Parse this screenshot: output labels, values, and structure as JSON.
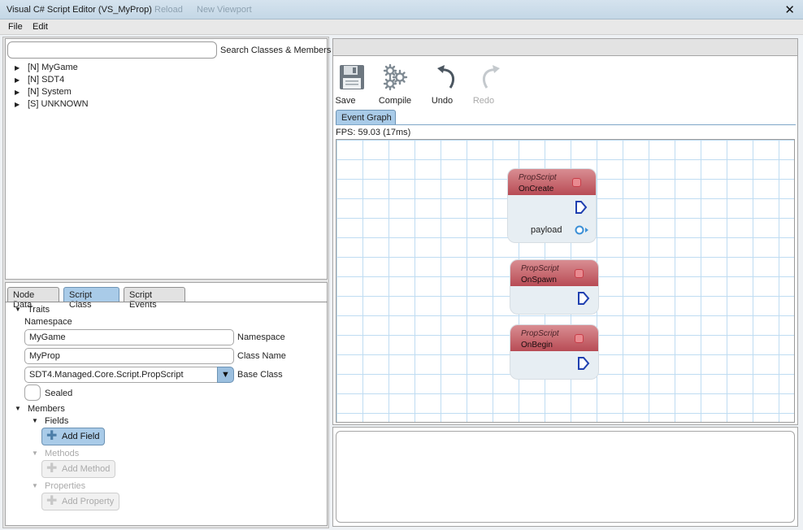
{
  "window": {
    "title": "Visual C# Script Editor (VS_MyProp)",
    "ghost_menu": [
      "Reload",
      "New Viewport"
    ]
  },
  "menubar": {
    "file": "File",
    "edit": "Edit"
  },
  "class_browser": {
    "search_value": "",
    "search_label": "Search Classes & Members",
    "tree": [
      {
        "label": "[N] MyGame"
      },
      {
        "label": "[N] SDT4"
      },
      {
        "label": "[N] System"
      },
      {
        "label": "[S] UNKNOWN"
      }
    ]
  },
  "tabs": [
    "Node Data",
    "Script Class",
    "Script Events"
  ],
  "active_tab": "Script Class",
  "traits": {
    "header": "Traits",
    "namespace_heading": "Namespace",
    "namespace_value": "MyGame",
    "namespace_label": "Namespace",
    "class_name_value": "MyProp",
    "class_name_label": "Class Name",
    "base_class_value": "SDT4.Managed.Core.Script.PropScript",
    "base_class_label": "Base Class",
    "sealed_label": "Sealed",
    "sealed_checked": false
  },
  "members": {
    "header": "Members",
    "fields_header": "Fields",
    "add_field": "Add Field",
    "methods_header": "Methods",
    "add_method": "Add Method",
    "properties_header": "Properties",
    "add_property": "Add Property"
  },
  "toolbar": {
    "save": "Save",
    "compile": "Compile",
    "undo": "Undo",
    "redo": "Redo"
  },
  "graph": {
    "tab": "Event Graph",
    "fps": "FPS: 59.03 (17ms)",
    "nodes": [
      {
        "class": "PropScript",
        "event": "OnCreate",
        "pin_label": "payload"
      },
      {
        "class": "PropScript",
        "event": "OnSpawn"
      },
      {
        "class": "PropScript",
        "event": "OnBegin"
      }
    ]
  },
  "colors": {
    "accent": "#a9cbe8",
    "node_header": "#c35a62",
    "grid": "#bfdcf2",
    "exec_pin": "#1f3fb0",
    "data_pin": "#3a8fd6"
  },
  "icons": {
    "save": "floppy-disk-icon",
    "compile": "gears-icon",
    "undo": "undo-arrow-icon",
    "redo": "redo-arrow-icon",
    "close": "close-icon",
    "add": "plus-icon"
  }
}
